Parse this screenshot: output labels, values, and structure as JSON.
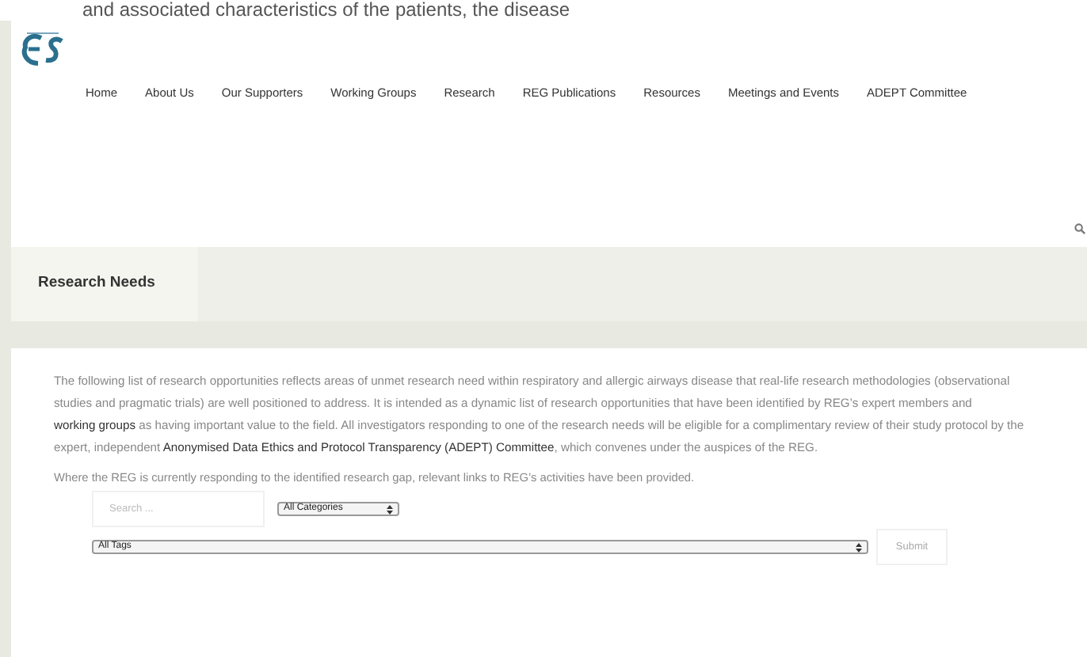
{
  "top_text": "and associated characteristics of the patients, the disease",
  "nav": [
    {
      "label": "Home"
    },
    {
      "label": "About Us"
    },
    {
      "label": "Our Supporters"
    },
    {
      "label": "Working Groups"
    },
    {
      "label": "Research"
    },
    {
      "label": "REG Publications"
    },
    {
      "label": "Resources"
    },
    {
      "label": "Meetings and Events"
    },
    {
      "label": "ADEPT Committee"
    }
  ],
  "page_title": "Research Needs",
  "intro": [
    {
      "kind": "text",
      "text": "The following list of research opportunities reflects areas of unmet research need within respiratory and allergic airways disease that real-life research methodologies (observational studies and pragmatic trials) are well positioned to address. It is intended as a dynamic list of research opportunities that have been identified by REG’s expert members and"
    },
    {
      "kind": "link",
      "text": "working groups"
    },
    {
      "kind": "text",
      "text": "as having important value to the field. All investigators responding to one of the research needs will be eligible for a complimentary review of their study protocol by the expert, independent"
    },
    {
      "kind": "link",
      "text": "Anonymised Data Ethics and Protocol Transparency (ADEPT) Committee"
    },
    {
      "kind": "text",
      "text": ", which convenes under the auspices of the REG."
    }
  ],
  "note": "Where the REG is currently responding to the identified research gap, relevant links to REG’s activities have been provided.",
  "search": {
    "placeholder": "Search ..."
  },
  "category_select": "All Categories",
  "tags_select": "All Tags",
  "submit": "Submit"
}
